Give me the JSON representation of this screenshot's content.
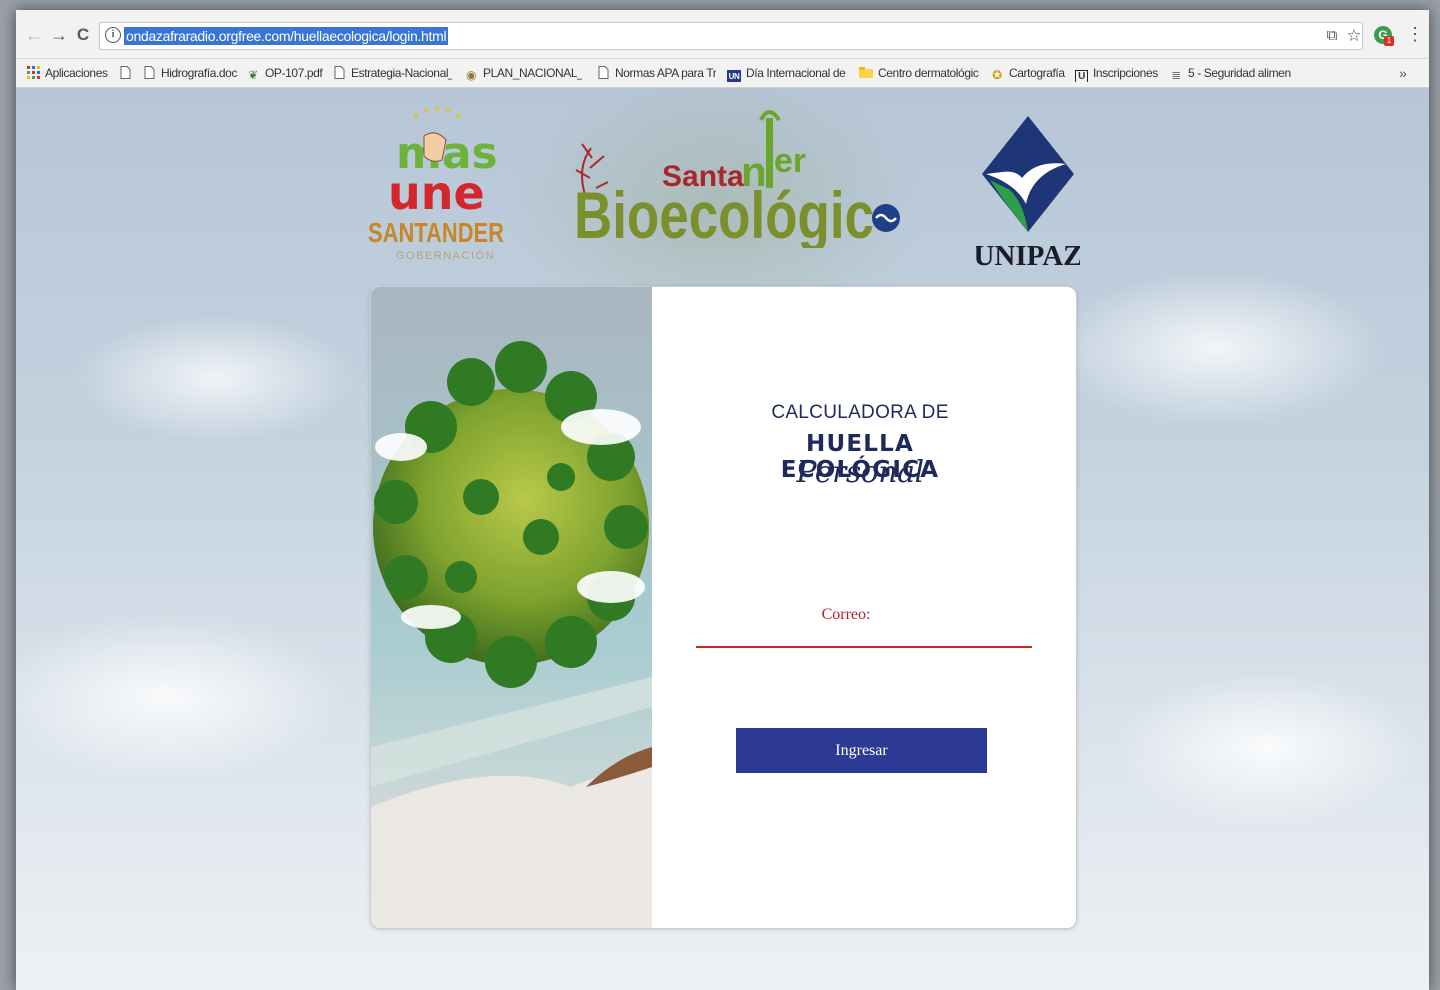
{
  "browser": {
    "url": "ondazafraradio.orgfree.com/huellaecologica/login.html",
    "nav": {
      "back": "←",
      "forward": "→",
      "reload": "C"
    },
    "info_glyph": "i",
    "extension_badge": "1",
    "menu_glyph": "⋮",
    "translate_glyph": "⧉",
    "star_glyph": "☆",
    "more_bookmarks": "»"
  },
  "bookmarks": [
    {
      "label": "Aplicaciones",
      "icon": "apps-grid-icon"
    },
    {
      "label": "",
      "icon": "page-icon"
    },
    {
      "label": "Hidrografía.doc",
      "icon": "page-icon"
    },
    {
      "label": "OP-107.pdf",
      "icon": "leaf-icon"
    },
    {
      "label": "Estrategia-Nacional_(",
      "icon": "page-icon"
    },
    {
      "label": "PLAN_NACIONAL_DE",
      "icon": "seal-icon"
    },
    {
      "label": "Normas APA para Tra",
      "icon": "page-icon"
    },
    {
      "label": "Día Internacional de l",
      "icon": "un-icon"
    },
    {
      "label": "Centro dermatológic",
      "icon": "folder-icon"
    },
    {
      "label": "Cartografía",
      "icon": "globe-icon"
    },
    {
      "label": "Inscripciones",
      "icon": "u-icon"
    },
    {
      "label": "5 - Seguridad alimen",
      "icon": "doc-lines-icon"
    }
  ],
  "logos": {
    "une_top": "mas",
    "une_mid": "une",
    "une_name": "SANTANDER",
    "une_sub": "GOBERNACIÓN",
    "bio_word1": "Santander",
    "bio_word2": "Bioecológico",
    "unipaz": "UNIPAZ"
  },
  "login": {
    "title_line1": "CALCULADORA DE",
    "title_line2": "HUELLA ECOLÓGICA",
    "title_line3": "Personal",
    "email_label": "Correo:",
    "email_value": "",
    "submit_label": "Ingresar"
  },
  "colors": {
    "accent_red": "#c62828",
    "button_blue": "#2c3a96",
    "title_navy": "#1f2a5a",
    "url_highlight": "#3875d7"
  }
}
